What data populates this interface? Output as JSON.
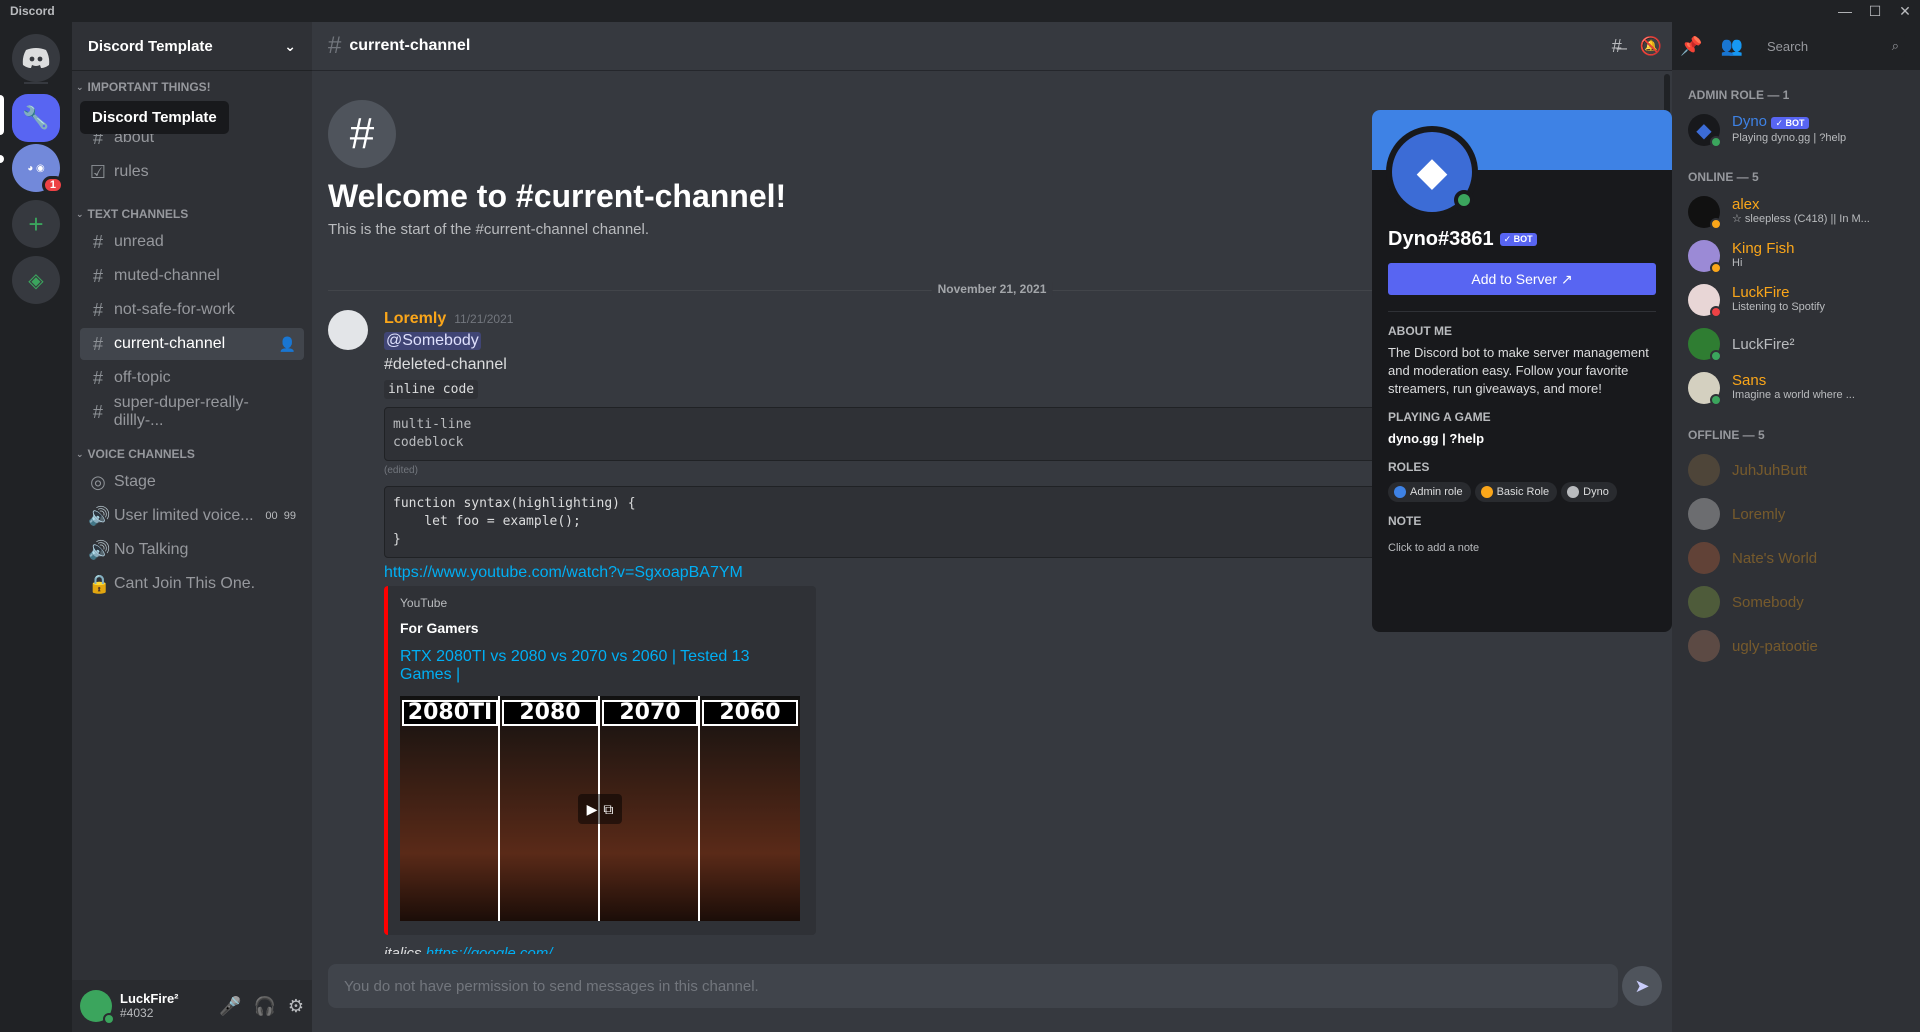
{
  "app": {
    "title": "Discord"
  },
  "server": {
    "name": "Discord Template",
    "tooltip": "Discord Template",
    "badge": "1"
  },
  "sidebar": {
    "categories": [
      {
        "name": "IMPORTANT THINGS!",
        "channels": [
          {
            "icon": "#",
            "name": "about"
          },
          {
            "icon": "☑",
            "name": "rules"
          }
        ]
      },
      {
        "name": "TEXT CHANNELS",
        "channels": [
          {
            "icon": "#",
            "name": "unread"
          },
          {
            "icon": "#",
            "name": "muted-channel"
          },
          {
            "icon": "#",
            "name": "not-safe-for-work"
          },
          {
            "icon": "#",
            "name": "current-channel"
          },
          {
            "icon": "#",
            "name": "off-topic"
          },
          {
            "icon": "#",
            "name": "super-duper-really-dillly-..."
          }
        ]
      },
      {
        "name": "VOICE CHANNELS",
        "channels": [
          {
            "icon": "stage-icon",
            "name": "Stage"
          },
          {
            "icon": "speaker-icon",
            "name": "User limited voice...",
            "extra_a": "00",
            "extra_b": "99"
          },
          {
            "icon": "speaker-icon",
            "name": "No Talking"
          },
          {
            "icon": "lock-icon",
            "name": "Cant Join This One."
          }
        ]
      }
    ]
  },
  "user": {
    "name": "LuckFire²",
    "tag": "#4032"
  },
  "channel": {
    "name": "current-channel",
    "welcome_title": "Welcome to #current-channel!",
    "welcome_sub": "This is the start of the #current-channel channel."
  },
  "search": {
    "placeholder": "Search"
  },
  "divider": {
    "date": "November 21, 2021"
  },
  "message": {
    "author": "Loremly",
    "timestamp": "11/21/2021",
    "mention": "@Somebody",
    "channel_ref": "#deleted-channel",
    "inline_code": "inline code",
    "codeblock": "multi-line\ncodeblock",
    "edited": "(edited)",
    "code2": "function syntax(highlighting) {\n    let foo = example();\n}",
    "link": "https://www.youtube.com/watch?v=SgxoapBA7YM",
    "embed": {
      "provider": "YouTube",
      "author": "For Gamers",
      "title": "RTX 2080TI vs 2080 vs 2070 vs 2060 | Tested 13 Games |",
      "labels": [
        "2080TI",
        "2080",
        "2070",
        "2060"
      ]
    },
    "italics_text": "italics",
    "italics_link": "https://google.com/"
  },
  "composer": {
    "placeholder": "You do not have permission to send messages in this channel."
  },
  "profile": {
    "name": "Dyno#3861",
    "bot_badge": "✓ BOT",
    "add_button": "Add to Server",
    "about_label": "ABOUT ME",
    "about": "The Discord bot to make server management and moderation easy. Follow your favorite streamers, run giveaways, and more!",
    "playing_label": "PLAYING A GAME",
    "playing": "dyno.gg | ?help",
    "roles_label": "ROLES",
    "roles": [
      {
        "name": "Admin role",
        "color": "#3e82e5"
      },
      {
        "name": "Basic Role",
        "color": "#faa61a"
      },
      {
        "name": "Dyno",
        "color": "#b9bbbe"
      }
    ],
    "note_label": "NOTE",
    "note_placeholder": "Click to add a note"
  },
  "members": {
    "groups": [
      {
        "label": "ADMIN ROLE — 1",
        "items": [
          {
            "name": "Dyno",
            "color": "#3e82e5",
            "activity": "Playing dyno.gg | ?help",
            "bot": "✓ BOT",
            "av": "#3c6cd6",
            "status": "#3ba55d"
          }
        ]
      },
      {
        "label": "ONLINE — 5",
        "items": [
          {
            "name": "alex",
            "color": "#faa61a",
            "activity": "☆ sleepless (C418) || In M...",
            "av": "#111111",
            "status": "#faa61a"
          },
          {
            "name": "King Fish",
            "color": "#faa61a",
            "activity": "Hi",
            "av": "#9b8ad6",
            "status": "#faa61a"
          },
          {
            "name": "LuckFire",
            "color": "#faa61a",
            "activity": "Listening to Spotify",
            "av": "#e8d6d6",
            "status": "#ed4245"
          },
          {
            "name": "LuckFire²",
            "color": "#b9bbbe",
            "activity": "",
            "av": "#2f7d32",
            "status": "#3ba55d"
          },
          {
            "name": "Sans",
            "color": "#faa61a",
            "activity": "Imagine a world where ...",
            "av": "#d4d0c0",
            "status": "#3ba55d"
          }
        ]
      },
      {
        "label": "OFFLINE — 5",
        "items": [
          {
            "name": "JuhJuhButt",
            "color": "#faa61a",
            "av": "#8a6a40"
          },
          {
            "name": "Loremly",
            "color": "#faa61a",
            "av": "#dddddd"
          },
          {
            "name": "Nate's World",
            "color": "#faa61a",
            "av": "#c0643a"
          },
          {
            "name": "Somebody",
            "color": "#faa61a",
            "av": "#88aa44"
          },
          {
            "name": "ugly-patootie",
            "color": "#faa61a",
            "av": "#b07a60"
          }
        ]
      }
    ]
  }
}
